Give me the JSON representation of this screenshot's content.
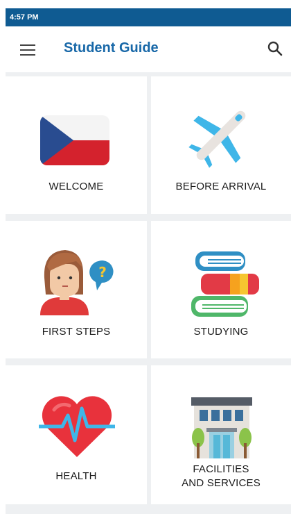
{
  "status_bar": {
    "time": "4:57 PM"
  },
  "app_bar": {
    "title": "Student Guide",
    "menu_icon": "hamburger-menu-icon",
    "search_icon": "search-icon"
  },
  "colors": {
    "status_bar": "#0f5b92",
    "title": "#1868a8",
    "grid_background": "#eef0f2"
  },
  "tiles": [
    {
      "label": "WELCOME",
      "icon": "czech-flag-icon"
    },
    {
      "label": "BEFORE ARRIVAL",
      "icon": "airplane-icon"
    },
    {
      "label": "FIRST STEPS",
      "icon": "student-question-icon"
    },
    {
      "label": "STUDYING",
      "icon": "books-icon"
    },
    {
      "label": "HEALTH",
      "icon": "heart-pulse-icon"
    },
    {
      "label_line1": "FACILITIES",
      "label_line2": "AND SERVICES",
      "icon": "building-icon"
    }
  ]
}
